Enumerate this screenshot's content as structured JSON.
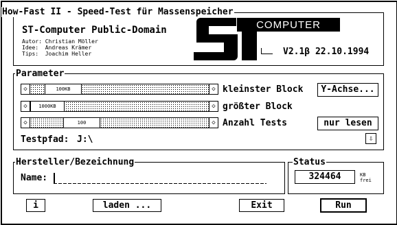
{
  "window": {
    "title": "How-Fast II - Speed-Test für Massenspeicher"
  },
  "header": {
    "product": "ST-Computer Public-Domain",
    "credits": "Autor: Christian Möller\nIdee:  Andreas Krämer\nTips:  Joachim Heller",
    "logo_text": "COMPUTER",
    "version": "V2.1β 22.10.1994"
  },
  "parameter": {
    "legend": "Parameter",
    "sliders": [
      {
        "value": "100KB",
        "label": "kleinster Block"
      },
      {
        "value": "1000KB",
        "label": "größter Block"
      },
      {
        "value": "100",
        "label": "Anzahl Tests"
      }
    ],
    "y_axis_button": "Y-Achse...",
    "read_only_button": "nur lesen",
    "path_label": "Testpfad:",
    "path_value": "J:\\",
    "arrow_left_glyph": "◇",
    "arrow_right_glyph": "◇",
    "down_glyph": "⇩"
  },
  "manufacturer": {
    "legend": "Hersteller/Bezeichnung",
    "name_label": "Name:",
    "name_value": ""
  },
  "status": {
    "legend": "Status",
    "value": "324464",
    "unit": "KB\nfrei"
  },
  "buttons": {
    "info": "i",
    "load": "laden ...",
    "exit": "Exit",
    "run": "Run"
  }
}
